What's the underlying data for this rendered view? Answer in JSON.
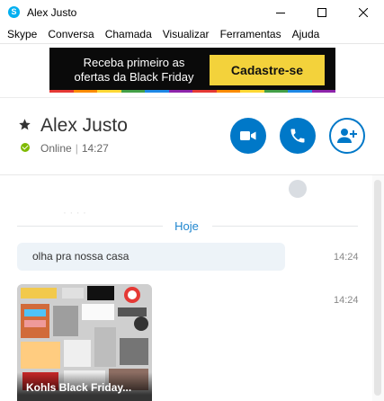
{
  "window": {
    "title": "Alex Justo",
    "app_icon": "skype-icon"
  },
  "menu": {
    "items": [
      "Skype",
      "Conversa",
      "Chamada",
      "Visualizar",
      "Ferramentas",
      "Ajuda"
    ]
  },
  "ad": {
    "line1": "Receba primeiro as",
    "line2": "ofertas da Black Friday",
    "button_label": "Cadastre-se",
    "background_color": "#0a0a0a",
    "button_color": "#f3d23b"
  },
  "contact": {
    "name": "Alex Justo",
    "status": "Online",
    "local_time": "14:27",
    "favorite_icon": "star-icon",
    "status_color": "#7fba00"
  },
  "actions": {
    "video_call_icon": "video-camera-icon",
    "audio_call_icon": "phone-icon",
    "add_people_icon": "add-person-icon",
    "accent_color": "#0078c8"
  },
  "chat": {
    "day_label": "Hoje",
    "messages": [
      {
        "text": "olha pra nossa casa",
        "time": "14:24"
      },
      {
        "media_title": "Kohls Black Friday...",
        "time": "14:24"
      }
    ]
  }
}
